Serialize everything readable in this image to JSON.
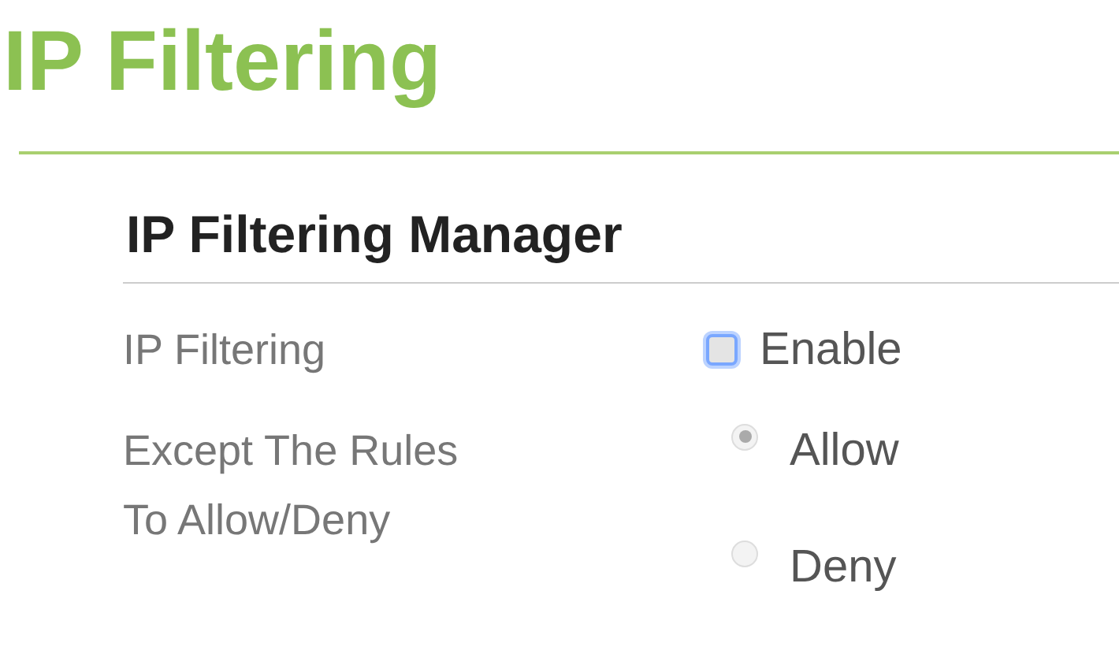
{
  "title": "IP Filtering",
  "section": {
    "heading": "IP Filtering Manager",
    "rows": [
      {
        "kind": "checkbox",
        "label": "IP Filtering",
        "options": [
          {
            "label": "Enable",
            "checked": false,
            "focused": true
          }
        ]
      },
      {
        "kind": "radio",
        "label": "Except The Rules To Allow/Deny",
        "disabled": true,
        "options": [
          {
            "label": "Allow",
            "selected": true
          },
          {
            "label": "Deny",
            "selected": false
          }
        ]
      }
    ]
  }
}
